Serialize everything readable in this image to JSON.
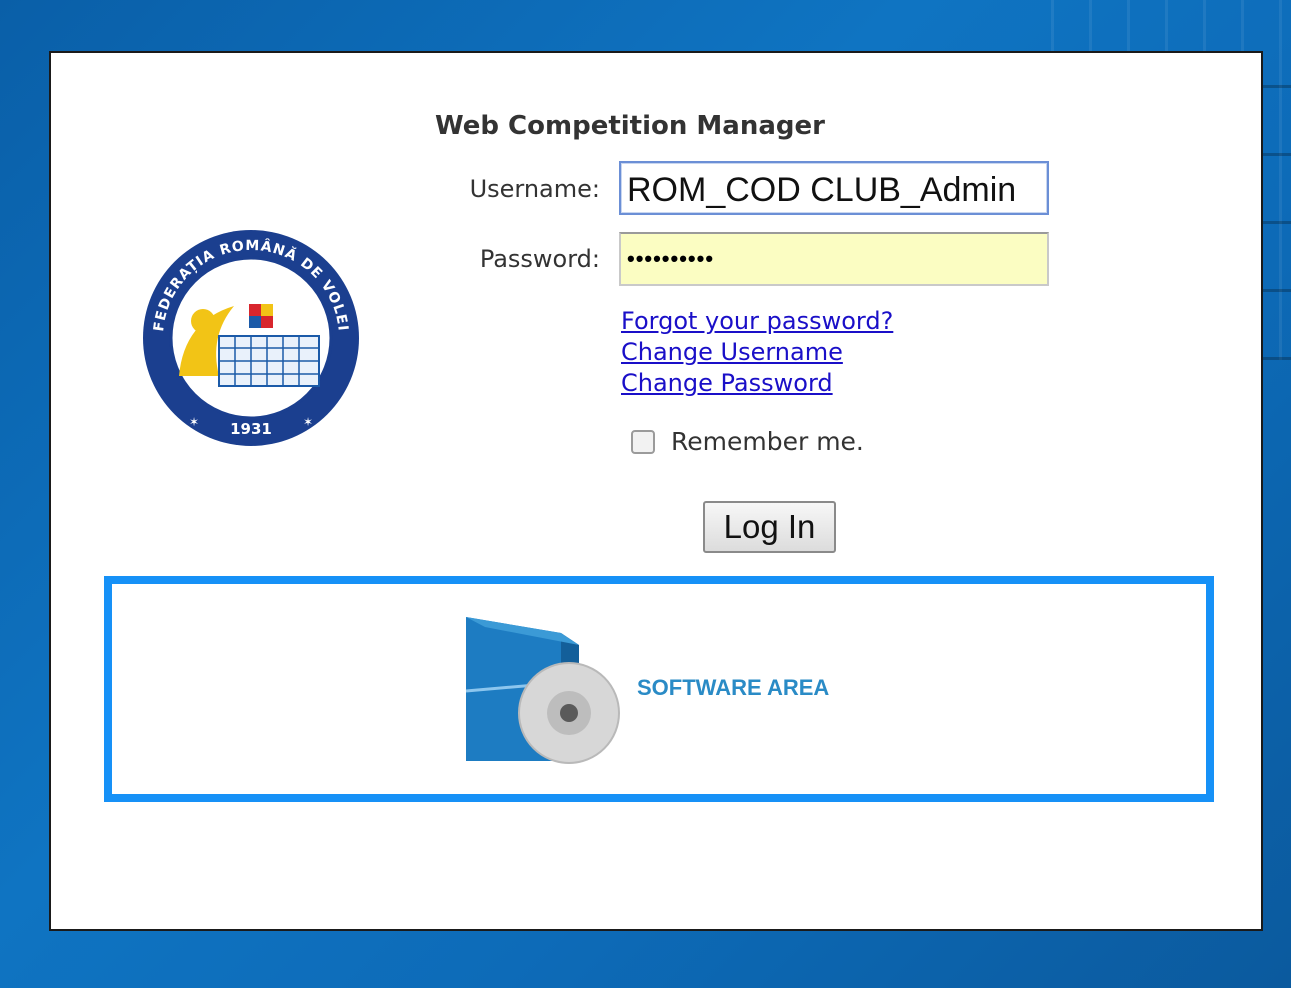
{
  "app": {
    "title": "Web Competition Manager"
  },
  "logo": {
    "name": "federatia-romana-de-volei-logo",
    "text_top": "FEDERAȚIA ROMÂNĂ DE VOLEI",
    "year": "1931"
  },
  "login": {
    "username_label": "Username:",
    "username_value": "ROM_COD CLUB_Admin",
    "password_label": "Password:",
    "password_value": "••••••••••",
    "forgot_link": "Forgot your password?",
    "change_username_link": "Change Username",
    "change_password_link": "Change Password",
    "remember_label": "Remember me.",
    "remember_checked": false,
    "login_button": "Log In"
  },
  "software_area": {
    "label": "SOFTWARE AREA",
    "icon": "software-box-icon"
  },
  "colors": {
    "background": "#0f74c2",
    "panel": "#ffffff",
    "software_border": "#1691f7",
    "software_label": "#2a8bc6",
    "link": "#1a0fc8",
    "password_fill": "#fbfdc2"
  }
}
